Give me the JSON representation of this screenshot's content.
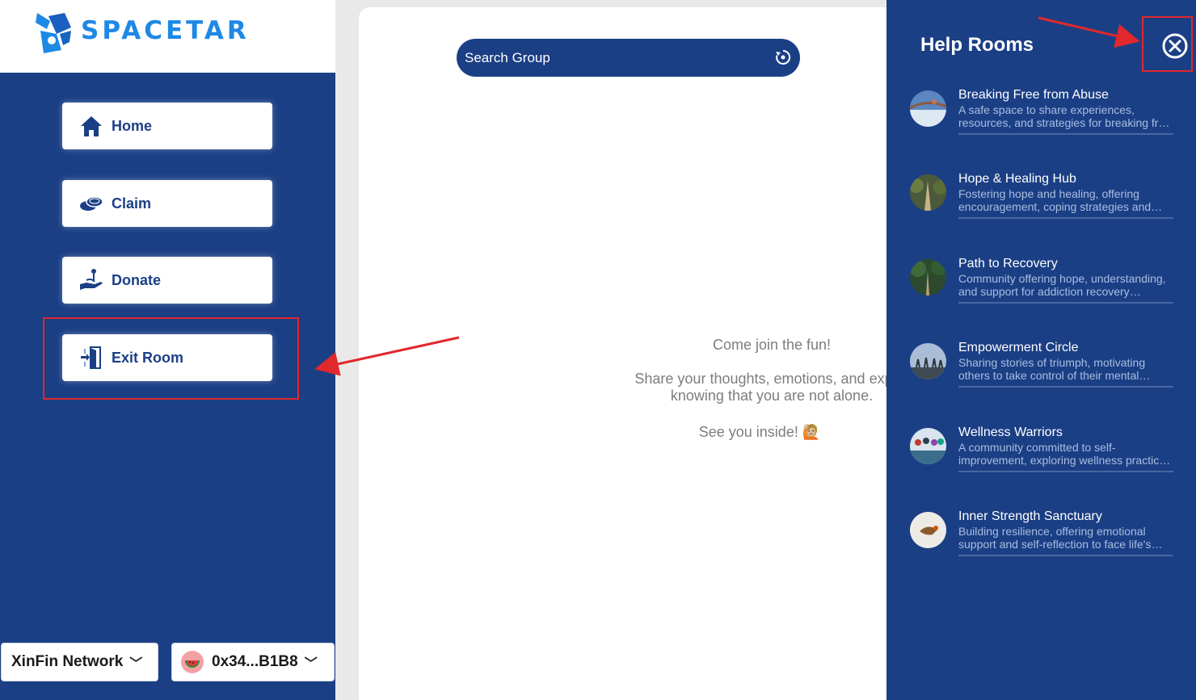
{
  "brand": {
    "name": "SPACETAR"
  },
  "nav": {
    "home": "Home",
    "claim": "Claim",
    "donate": "Donate",
    "exit_room": "Exit Room"
  },
  "footer": {
    "network": "XinFin Network",
    "wallet": "0x34...B1B8"
  },
  "search": {
    "placeholder": "Search Group"
  },
  "welcome": {
    "line1": "Come join the fun!",
    "line2": "Share your thoughts, emotions, and experi",
    "line3": "knowing that you are not alone.",
    "line4": "See you inside! 🙋🏼"
  },
  "drawer": {
    "title": "Help Rooms",
    "rooms": [
      {
        "name": "Breaking Free from Abuse",
        "desc": "A safe space to share experiences, resources, and strategies for breaking free from abuse."
      },
      {
        "name": "Hope & Healing Hub",
        "desc": "Fostering hope and healing, offering encouragement, coping strategies and support."
      },
      {
        "name": "Path to Recovery",
        "desc": "Community offering hope, understanding, and support for addiction recovery journeys."
      },
      {
        "name": "Empowerment Circle",
        "desc": "Sharing stories of triumph, motivating others to take control of their mental health."
      },
      {
        "name": "Wellness Warriors",
        "desc": "A community committed to self-improvement, exploring wellness practices together."
      },
      {
        "name": "Inner Strength Sanctuary",
        "desc": "Building resilience, offering emotional support and self-reflection to face life's challenges."
      }
    ]
  },
  "icons": {
    "home": "home-icon",
    "claim": "coins-icon",
    "donate": "donate-hand-icon",
    "exit": "exit-door-icon",
    "refresh": "refresh-icon",
    "close": "close-circle-icon",
    "chevron": "chevron-down-icon"
  },
  "colors": {
    "primary": "#1b3f85",
    "accent": "#1e88e5",
    "annotation": "#e0282d"
  }
}
